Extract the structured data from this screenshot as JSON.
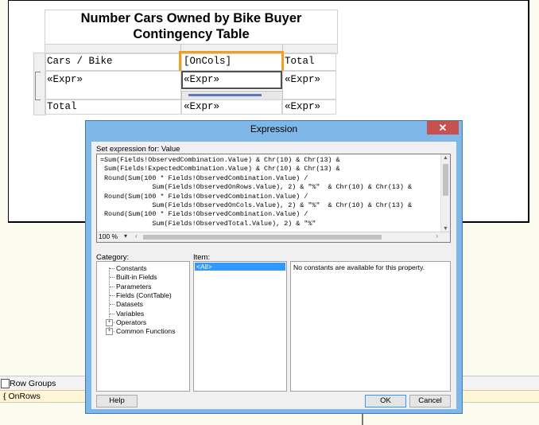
{
  "report": {
    "title_line1": "Number Cars Owned by Bike Buyer",
    "title_line2": "Contingency Table",
    "cells": {
      "header_corner": "Cars / Bike",
      "header_oncols": "[OnCols]",
      "header_total": "Total",
      "row_expr_1": "«Expr»",
      "row_expr_2": "«Expr»",
      "row_expr_3": "«Expr»",
      "total_label": "Total",
      "total_expr_1": "«Expr»",
      "total_expr_2": "«Expr»"
    }
  },
  "groups_panel": {
    "row_groups_label": "Row Groups",
    "group_item": "OnRows"
  },
  "dialog": {
    "title": "Expression",
    "close_glyph": "✕",
    "set_expression_label": "Set expression for: Value",
    "expression_lines": [
      "=Sum(Fields!ObservedCombination.Value) & Chr(10) & Chr(13) &",
      " Sum(Fields!ExpectedCombination.Value) & Chr(10) & Chr(13) &",
      " Round(Sum(100 * Fields!ObservedCombination.Value) /",
      "             Sum(Fields!ObservedOnRows.Value), 2) & \"%\"  & Chr(10) & Chr(13) &",
      " Round(Sum(100 * Fields!ObservedCombination.Value) /",
      "             Sum(Fields!ObservedOnCols.Value), 2) & \"%\"  & Chr(10) & Chr(13) &",
      " Round(Sum(100 * Fields!ObservedCombination.Value) /",
      "             Sum(Fields!ObservedTotal.Value), 2) & \"%\""
    ],
    "zoom": "100 %",
    "category_label": "Category:",
    "item_label": "Item:",
    "categories": [
      {
        "label": "Constants",
        "expandable": false
      },
      {
        "label": "Built-in Fields",
        "expandable": false
      },
      {
        "label": "Parameters",
        "expandable": false
      },
      {
        "label": "Fields (ContTable)",
        "expandable": false
      },
      {
        "label": "Datasets",
        "expandable": false
      },
      {
        "label": "Variables",
        "expandable": false
      },
      {
        "label": "Operators",
        "expandable": true
      },
      {
        "label": "Common Functions",
        "expandable": true
      }
    ],
    "items": [
      "<All>"
    ],
    "description": "No constants are available for this property.",
    "help_button": "Help",
    "ok_button": "OK",
    "cancel_button": "Cancel"
  },
  "colors": {
    "dialog_frame": "#7eb7e8",
    "close_button": "#c75050",
    "selection": "#3399ff",
    "group_marker": "#f0a020"
  }
}
